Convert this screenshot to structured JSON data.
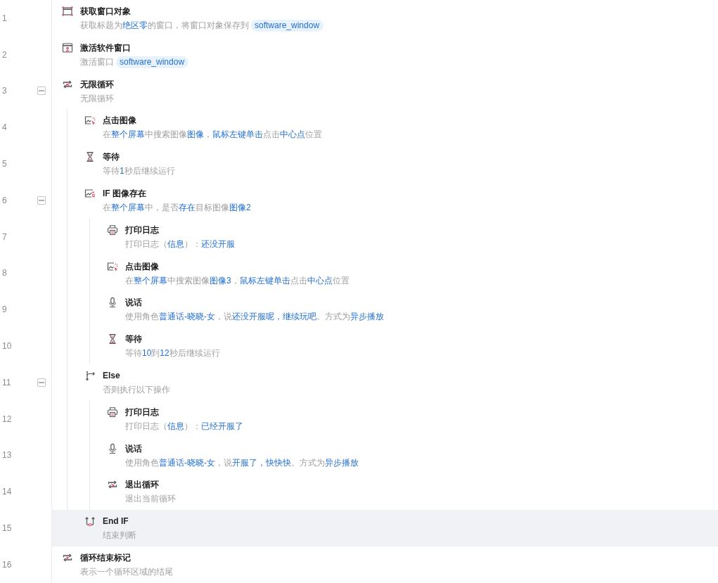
{
  "steps": [
    {
      "line": "1",
      "kind": "get-window",
      "title": "获取窗口对象",
      "selected": false,
      "description": [
        {
          "kind": "text",
          "text": "获取标题为"
        },
        {
          "kind": "param",
          "text": "绝区零"
        },
        {
          "kind": "text",
          "text": "的窗口，将窗口对象保存到"
        },
        {
          "kind": "variable",
          "text": "software_window"
        }
      ]
    },
    {
      "line": "2",
      "kind": "activate-window",
      "title": "激活软件窗口",
      "selected": false,
      "description": [
        {
          "kind": "text",
          "text": "激活窗口"
        },
        {
          "kind": "variable",
          "text": "software_window"
        }
      ]
    },
    {
      "line": "3",
      "kind": "loop",
      "title": "无限循环",
      "selected": false,
      "expanded": true,
      "description": [
        {
          "kind": "text",
          "text": "无限循环"
        }
      ],
      "children": [
        {
          "line": "4",
          "kind": "click-image",
          "title": "点击图像",
          "selected": false,
          "description": [
            {
              "kind": "text",
              "text": "在"
            },
            {
              "kind": "param",
              "text": "整个屏幕"
            },
            {
              "kind": "text",
              "text": "中搜索图像"
            },
            {
              "kind": "param",
              "text": "图像"
            },
            {
              "kind": "text",
              "text": "，"
            },
            {
              "kind": "param",
              "text": "鼠标左键单击"
            },
            {
              "kind": "text",
              "text": "点击"
            },
            {
              "kind": "param",
              "text": "中心点"
            },
            {
              "kind": "text",
              "text": "位置"
            }
          ]
        },
        {
          "line": "5",
          "kind": "wait",
          "title": "等待",
          "selected": false,
          "description": [
            {
              "kind": "text",
              "text": "等待"
            },
            {
              "kind": "param",
              "text": "1"
            },
            {
              "kind": "text",
              "text": "秒后继续运行"
            }
          ]
        },
        {
          "line": "6",
          "kind": "if-image",
          "title": "IF 图像存在",
          "selected": false,
          "expanded": true,
          "description": [
            {
              "kind": "text",
              "text": "在"
            },
            {
              "kind": "param",
              "text": "整个屏幕"
            },
            {
              "kind": "text",
              "text": "中，是否"
            },
            {
              "kind": "param",
              "text": "存在"
            },
            {
              "kind": "text",
              "text": "目标图像"
            },
            {
              "kind": "param",
              "text": "图像2"
            }
          ],
          "children": [
            {
              "line": "7",
              "kind": "log",
              "title": "打印日志",
              "selected": false,
              "description": [
                {
                  "kind": "text",
                  "text": "打印日志（"
                },
                {
                  "kind": "param",
                  "text": "信息"
                },
                {
                  "kind": "text",
                  "text": "）："
                },
                {
                  "kind": "param",
                  "text": "还没开服"
                }
              ]
            },
            {
              "line": "8",
              "kind": "click-image",
              "title": "点击图像",
              "selected": false,
              "description": [
                {
                  "kind": "text",
                  "text": "在"
                },
                {
                  "kind": "param",
                  "text": "整个屏幕"
                },
                {
                  "kind": "text",
                  "text": "中搜索图像"
                },
                {
                  "kind": "param",
                  "text": "图像3"
                },
                {
                  "kind": "text",
                  "text": "，"
                },
                {
                  "kind": "param",
                  "text": "鼠标左键单击"
                },
                {
                  "kind": "text",
                  "text": "点击"
                },
                {
                  "kind": "param",
                  "text": "中心点"
                },
                {
                  "kind": "text",
                  "text": "位置"
                }
              ]
            },
            {
              "line": "9",
              "kind": "speak",
              "title": "说话",
              "selected": false,
              "description": [
                {
                  "kind": "text",
                  "text": "使用角色"
                },
                {
                  "kind": "param",
                  "text": "普通话-晓晓-女"
                },
                {
                  "kind": "text",
                  "text": "，说"
                },
                {
                  "kind": "param",
                  "text": "还没开服呢，继续玩吧"
                },
                {
                  "kind": "text",
                  "text": "。方式为"
                },
                {
                  "kind": "param",
                  "text": "异步播放"
                }
              ]
            },
            {
              "line": "10",
              "kind": "wait",
              "title": "等待",
              "selected": false,
              "description": [
                {
                  "kind": "text",
                  "text": "等待"
                },
                {
                  "kind": "param",
                  "text": "10"
                },
                {
                  "kind": "text",
                  "text": "到"
                },
                {
                  "kind": "param",
                  "text": "12"
                },
                {
                  "kind": "text",
                  "text": "秒后继续运行"
                }
              ]
            }
          ]
        },
        {
          "line": "11",
          "kind": "else",
          "title": "Else",
          "selected": false,
          "expanded": true,
          "description": [
            {
              "kind": "text",
              "text": "否则执行以下操作"
            }
          ],
          "children": [
            {
              "line": "12",
              "kind": "log",
              "title": "打印日志",
              "selected": false,
              "description": [
                {
                  "kind": "text",
                  "text": "打印日志（"
                },
                {
                  "kind": "param",
                  "text": "信息"
                },
                {
                  "kind": "text",
                  "text": "）："
                },
                {
                  "kind": "param",
                  "text": "已经开服了"
                }
              ]
            },
            {
              "line": "13",
              "kind": "speak",
              "title": "说话",
              "selected": false,
              "description": [
                {
                  "kind": "text",
                  "text": "使用角色"
                },
                {
                  "kind": "param",
                  "text": "普通话-晓晓-女"
                },
                {
                  "kind": "text",
                  "text": "，说"
                },
                {
                  "kind": "param",
                  "text": "开服了，快快快"
                },
                {
                  "kind": "text",
                  "text": "。方式为"
                },
                {
                  "kind": "param",
                  "text": "异步播放"
                }
              ]
            },
            {
              "line": "14",
              "kind": "break",
              "title": "退出循环",
              "selected": false,
              "description": [
                {
                  "kind": "text",
                  "text": "退出当前循环"
                }
              ]
            }
          ]
        },
        {
          "line": "15",
          "kind": "end-if",
          "title": "End IF",
          "selected": true,
          "description": [
            {
              "kind": "text",
              "text": "结束判断"
            }
          ]
        }
      ]
    },
    {
      "line": "16",
      "kind": "loop-end",
      "title": "循环结束标记",
      "selected": false,
      "description": [
        {
          "kind": "text",
          "text": "表示一个循环区域的结尾"
        }
      ]
    }
  ]
}
